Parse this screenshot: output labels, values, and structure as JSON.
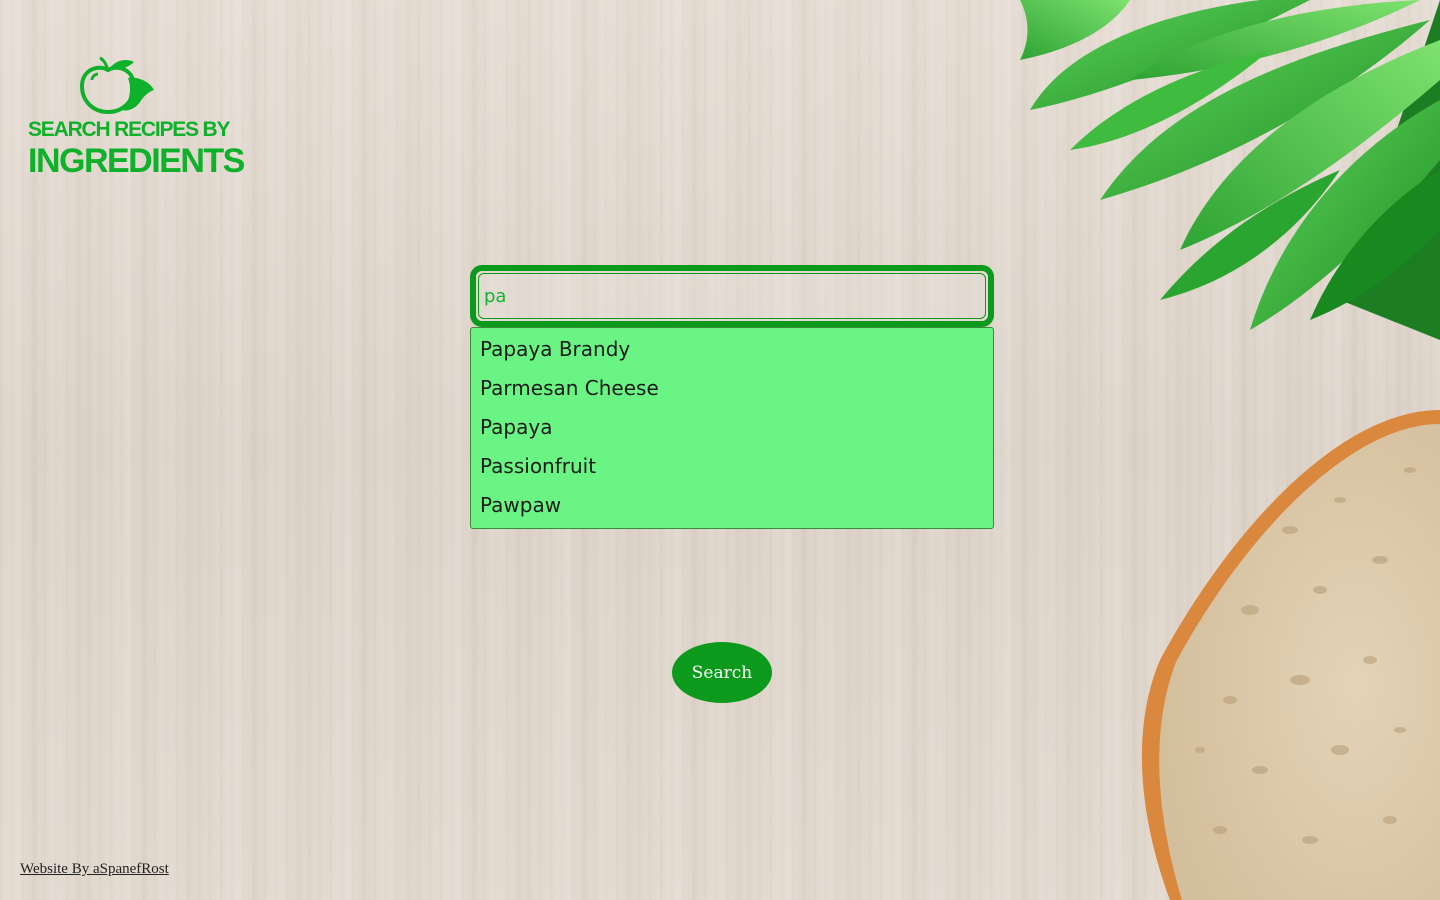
{
  "logo": {
    "line1": "SEARCH RECIPES BY",
    "line2": "INGREDIENTS",
    "icon": "apple-icon",
    "color": "#0fb02a"
  },
  "search": {
    "value": "pa",
    "border_color": "#0c9a1c",
    "text_color": "#11b52e"
  },
  "suggestions": {
    "background": "#69f484",
    "items": [
      {
        "label": "Papaya Brandy"
      },
      {
        "label": "Parmesan Cheese"
      },
      {
        "label": "Papaya"
      },
      {
        "label": "Passionfruit"
      },
      {
        "label": "Pawpaw"
      }
    ]
  },
  "button": {
    "label": "Search",
    "color": "#0c9a1c"
  },
  "footer": {
    "credit": "Website By aSpanefRost"
  }
}
